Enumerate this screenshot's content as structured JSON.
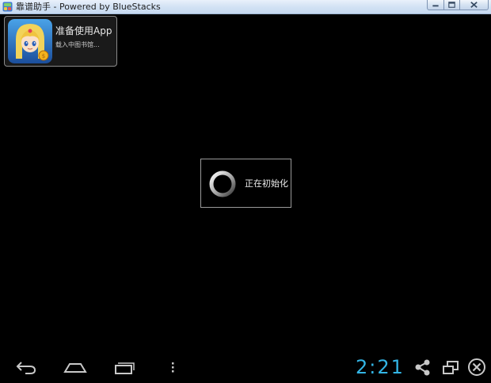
{
  "window": {
    "title": "靠谱助手 - Powered by BlueStacks",
    "app_icon": "bluestacks-icon",
    "caption_buttons": [
      "minimize",
      "maximize",
      "close"
    ]
  },
  "notification": {
    "avatar_icon": "game-character-avatar",
    "title": "准备使用App",
    "subtitle": "载入中图书馆..."
  },
  "loading_dialog": {
    "spinner_icon": "spinner-icon",
    "text": "正在初始化"
  },
  "navbar": {
    "buttons": [
      "back-icon",
      "home-icon",
      "recent-apps-icon",
      "menu-icon"
    ],
    "clock": "2:21",
    "right_icons": [
      "share-icon",
      "window-mode-icon",
      "close-circle-icon"
    ]
  },
  "colors": {
    "background": "#000000",
    "clock": "#33b5e5",
    "nav_icon": "#c8c8c8"
  }
}
